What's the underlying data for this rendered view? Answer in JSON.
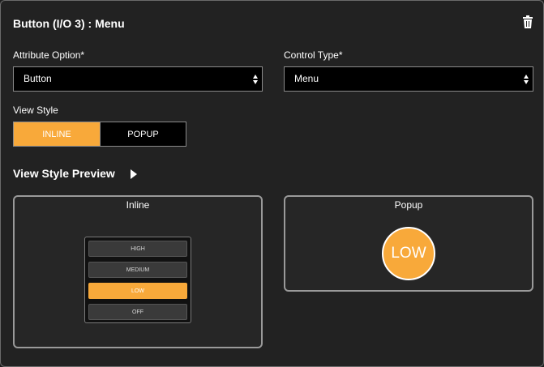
{
  "header": {
    "title": "Button (I/O 3) : Menu",
    "delete_icon": "trash-icon"
  },
  "attribute_option": {
    "label": "Attribute Option*",
    "value": "Button"
  },
  "control_type": {
    "label": "Control Type*",
    "value": "Menu"
  },
  "view_style": {
    "label": "View Style",
    "options": [
      "INLINE",
      "POPUP"
    ],
    "selected": "INLINE"
  },
  "preview": {
    "title": "View Style Preview",
    "inline": {
      "title": "Inline",
      "items": [
        "HIGH",
        "MEDIUM",
        "LOW",
        "OFF"
      ],
      "selected": "LOW"
    },
    "popup": {
      "title": "Popup",
      "value": "LOW"
    }
  },
  "colors": {
    "accent": "#f8a93a",
    "background": "#222222",
    "field": "#000000",
    "border": "#8a8a8a"
  }
}
